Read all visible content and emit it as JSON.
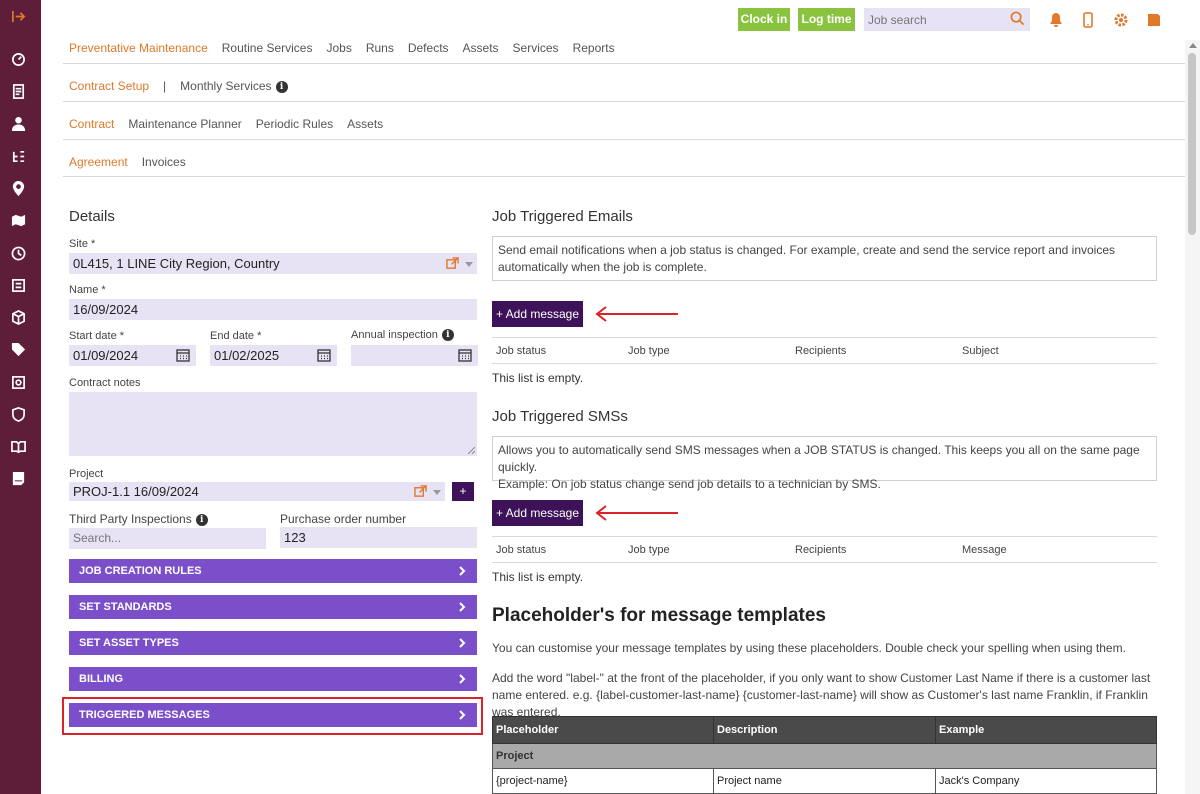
{
  "topbar": {
    "clock_in": "Clock in",
    "log_time": "Log time",
    "job_search_placeholder": "Job search"
  },
  "nav": {
    "main": [
      "Preventative Maintenance",
      "Routine Services",
      "Jobs",
      "Runs",
      "Defects",
      "Assets",
      "Services",
      "Reports"
    ],
    "sub1": [
      "Contract Setup",
      "|",
      "Monthly Services"
    ],
    "sub2": [
      "Contract",
      "Maintenance Planner",
      "Periodic Rules",
      "Assets"
    ],
    "sub3": [
      "Agreement",
      "Invoices"
    ]
  },
  "details": {
    "title": "Details",
    "site_label": "Site *",
    "site_value": "0L415, 1 LINE City Region, Country",
    "name_label": "Name *",
    "name_value": "16/09/2024",
    "start_label": "Start date *",
    "start_value": "01/09/2024",
    "end_label": "End date *",
    "end_value": "01/02/2025",
    "annual_label": "Annual inspection",
    "notes_label": "Contract notes",
    "project_label": "Project",
    "project_value": "PROJ-1.1 16/09/2024",
    "project_add": "+",
    "third_party_label": "Third Party Inspections",
    "third_party_placeholder": "Search...",
    "po_label": "Purchase order number",
    "po_value": "123"
  },
  "accordions": [
    "JOB CREATION RULES",
    "SET STANDARDS",
    "SET ASSET TYPES",
    "BILLING",
    "TRIGGERED MESSAGES"
  ],
  "emails": {
    "title": "Job Triggered Emails",
    "info": "Send email notifications when a job status is changed. For example, create and send the service report and invoices automatically when the job is complete.",
    "add_button": "+ Add message",
    "columns": [
      "Job status",
      "Job type",
      "Recipients",
      "Subject"
    ],
    "empty": "This list is empty."
  },
  "sms": {
    "title": "Job Triggered SMSs",
    "info_line1": "Allows you to automatically send SMS messages when a JOB STATUS is changed. This keeps you all on the same page quickly.",
    "info_line2": "Example: On job status change send job details to a technician by SMS.",
    "add_button": "+ Add message",
    "columns": [
      "Job status",
      "Job type",
      "Recipients",
      "Message"
    ],
    "empty": "This list is empty."
  },
  "placeholders": {
    "title": "Placeholder's for message templates",
    "para1": "You can customise your message templates by using these placeholders. Double check your spelling when using them.",
    "para2": "Add the word \"label-\" at the front of the placeholder, if you only want to show Customer Last Name if there is a customer last name entered. e.g. {label-customer-last-name} {customer-last-name} will show as Customer's last name Franklin, if Franklin was entered.",
    "columns": [
      "Placeholder",
      "Description",
      "Example"
    ],
    "group": "Project",
    "row": [
      "{project-name}",
      "Project name",
      "Jack's Company"
    ]
  },
  "colors": {
    "sidebar": "#5e1e3a",
    "accent_orange": "#e0792a",
    "green": "#8ac43f",
    "purple": "#7b4fc9",
    "dark_purple": "#3d1259",
    "highlight_red": "#d9252a"
  }
}
